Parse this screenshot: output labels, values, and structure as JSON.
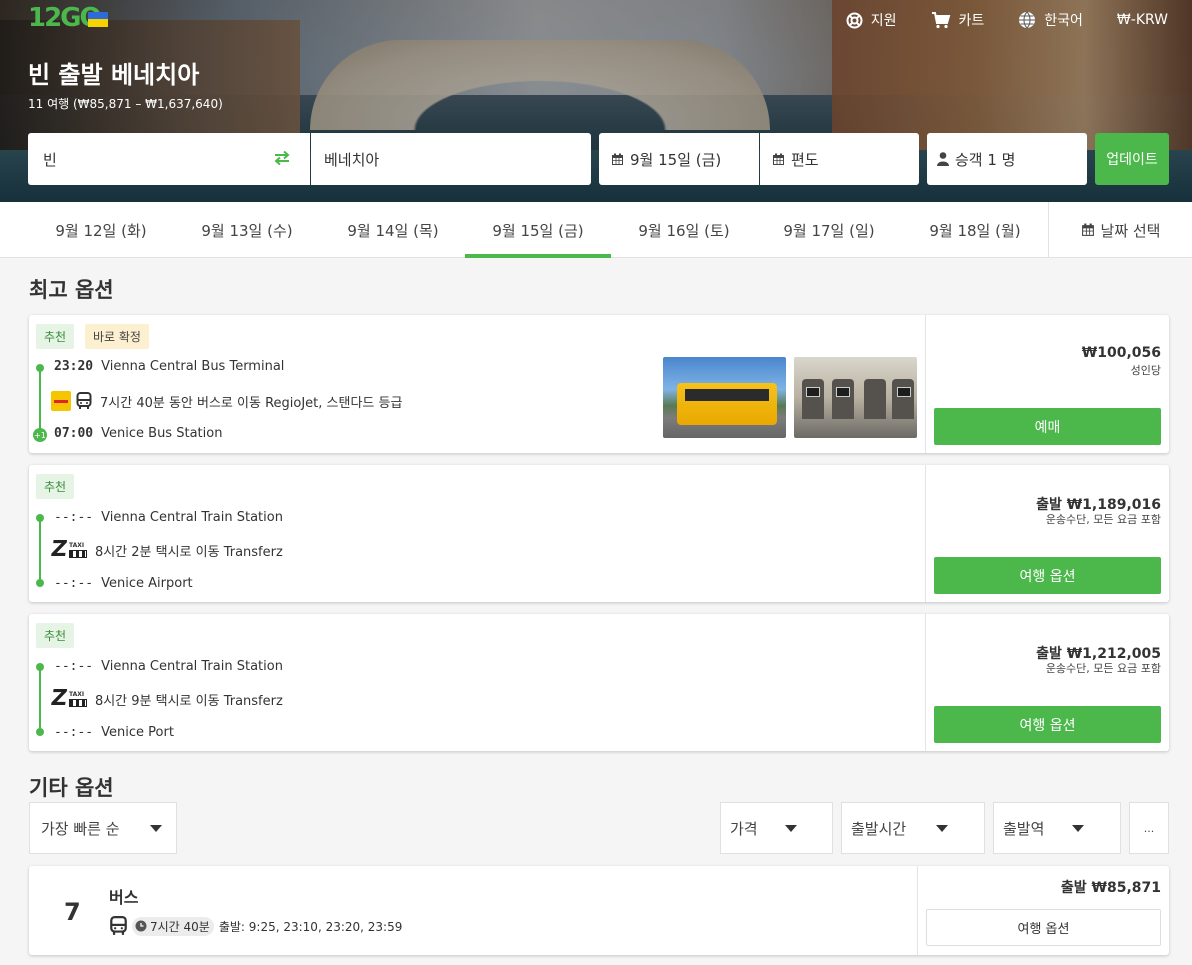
{
  "header": {
    "logo_text": "12GO",
    "nav": [
      {
        "label": "지원",
        "icon": "lifebuoy-icon"
      },
      {
        "label": "카트",
        "icon": "cart-icon"
      },
      {
        "label": "한국어",
        "icon": "globe-icon"
      },
      {
        "label": "₩-KRW",
        "icon": "currency"
      }
    ],
    "title": "빈 출발 베네치아",
    "subtitle": "11 여행 (₩85,871 – ₩1,637,640)"
  },
  "search": {
    "from": "빈",
    "to": "베네치아",
    "date": "9월 15일 (금)",
    "return": "편도",
    "passengers": "승객 1 명",
    "update_label": "업데이트"
  },
  "date_tabs": {
    "tabs": [
      "9월 12일 (화)",
      "9월 13일 (수)",
      "9월 14일 (목)",
      "9월 15일 (금)",
      "9월 16일 (토)",
      "9월 17일 (일)",
      "9월 18일 (월)"
    ],
    "active_index": 3,
    "picker_label": "날짜 선택"
  },
  "best": {
    "heading": "최고 옵션",
    "cards": [
      {
        "badges": [
          "추천",
          "바로 확정"
        ],
        "dep_time": "23:20",
        "dep_station": "Vienna Central Bus Terminal",
        "desc": "7시간 40분 동안 버스로 이동 RegioJet, 스탠다드 등급",
        "arr_time": "07:00",
        "arr_station": "Venice Bus Station",
        "next_day": "+1",
        "price": "₩100,056",
        "price_note": "성인당",
        "button": "예매"
      },
      {
        "badges": [
          "추천"
        ],
        "dep_time": "--:--",
        "dep_station": "Vienna Central Train Station",
        "desc": "8시간 2분 택시로 이동 Transferz",
        "arr_time": "--:--",
        "arr_station": "Venice Airport",
        "price": "출발 ₩1,189,016",
        "price_note": "운송수단, 모든 요금 포함",
        "button": "여행 옵션",
        "logo_text": "Z",
        "logo_small": "TAXI"
      },
      {
        "badges": [
          "추천"
        ],
        "dep_time": "--:--",
        "dep_station": "Vienna Central Train Station",
        "desc": "8시간 9분 택시로 이동 Transferz",
        "arr_time": "--:--",
        "arr_station": "Venice Port",
        "price": "출발 ₩1,212,005",
        "price_note": "운송수단, 모든 요금 포함",
        "button": "여행 옵션",
        "logo_text": "Z",
        "logo_small": "TAXI"
      }
    ]
  },
  "other": {
    "heading": "기타 옵션",
    "sort": "가장 빠른 순",
    "filters": [
      "가격",
      "출발시간",
      "출발역"
    ],
    "more": "...",
    "result": {
      "count": "7",
      "mode": "버스",
      "duration": "7시간 40분",
      "departures": "출발: 9:25, 23:10, 23:20, 23:59",
      "price": "출발 ₩85,871",
      "button": "여행 옵션"
    }
  },
  "colors": {
    "accent": "#4cb84c",
    "badge_rec_bg": "#e5f4e5",
    "badge_instant_bg": "#fdf0d0"
  }
}
